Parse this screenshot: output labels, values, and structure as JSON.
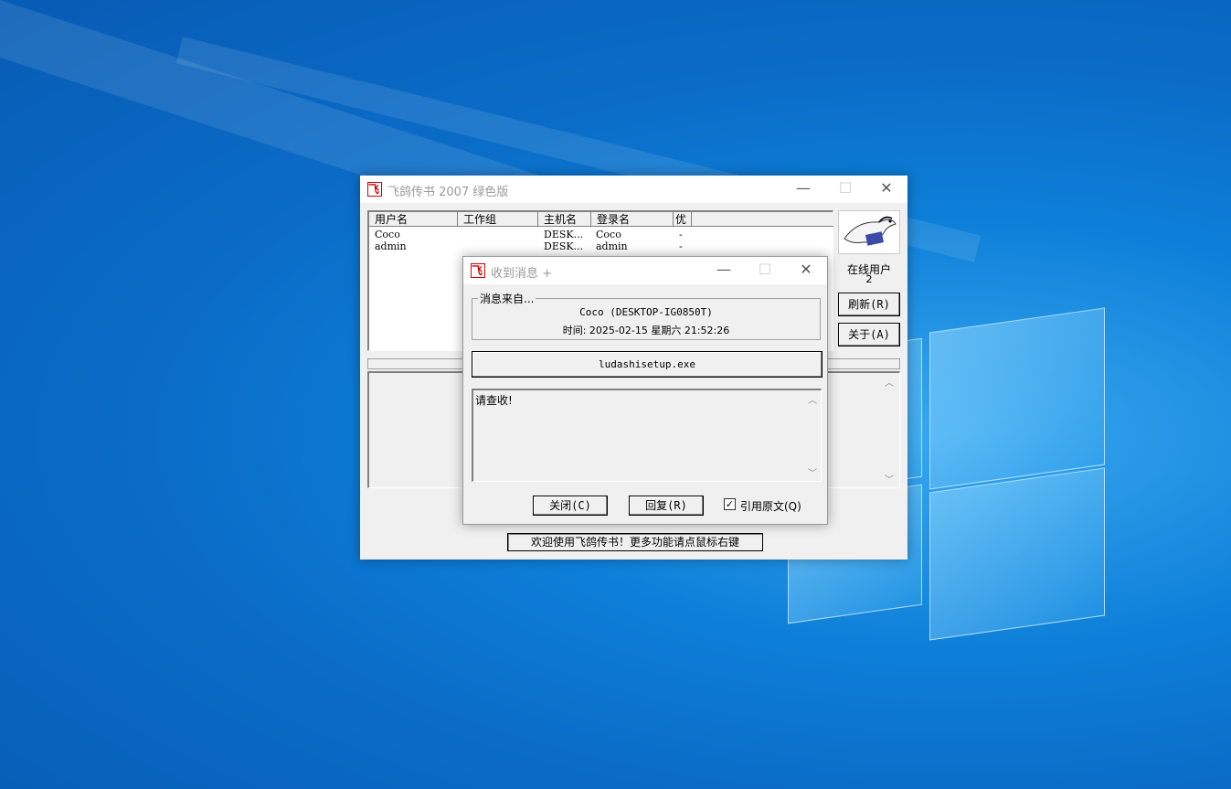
{
  "main_window": {
    "title": "飞鸽传书 2007 绿色版",
    "columns": [
      "用户名",
      "工作组",
      "主机名",
      "登录名",
      "优"
    ],
    "rows": [
      {
        "user": "Coco",
        "group": "",
        "host": "DESK...",
        "login": "Coco",
        "priority": "-"
      },
      {
        "user": "admin",
        "group": "",
        "host": "DESK...",
        "login": "admin",
        "priority": "-"
      }
    ],
    "online_label": "在线用户",
    "online_count": "2",
    "refresh_button": "刷新(R)",
    "about_button": "关于(A)",
    "status_text": "欢迎使用飞鸽传书！更多功能请点鼠标右键"
  },
  "message_dialog": {
    "title": "收到消息 +",
    "group_label": "消息来自...",
    "sender": "Coco (DESKTOP-IG0850T)",
    "time_label": "时间: 2025-02-15 星期六 21:52:26",
    "attachment": "ludashisetup.exe",
    "message": "请查收!",
    "close_button": "关闭(C)",
    "reply_button": "回复(R)",
    "quote_label": "引用原文(Q)",
    "quote_checked": true
  }
}
